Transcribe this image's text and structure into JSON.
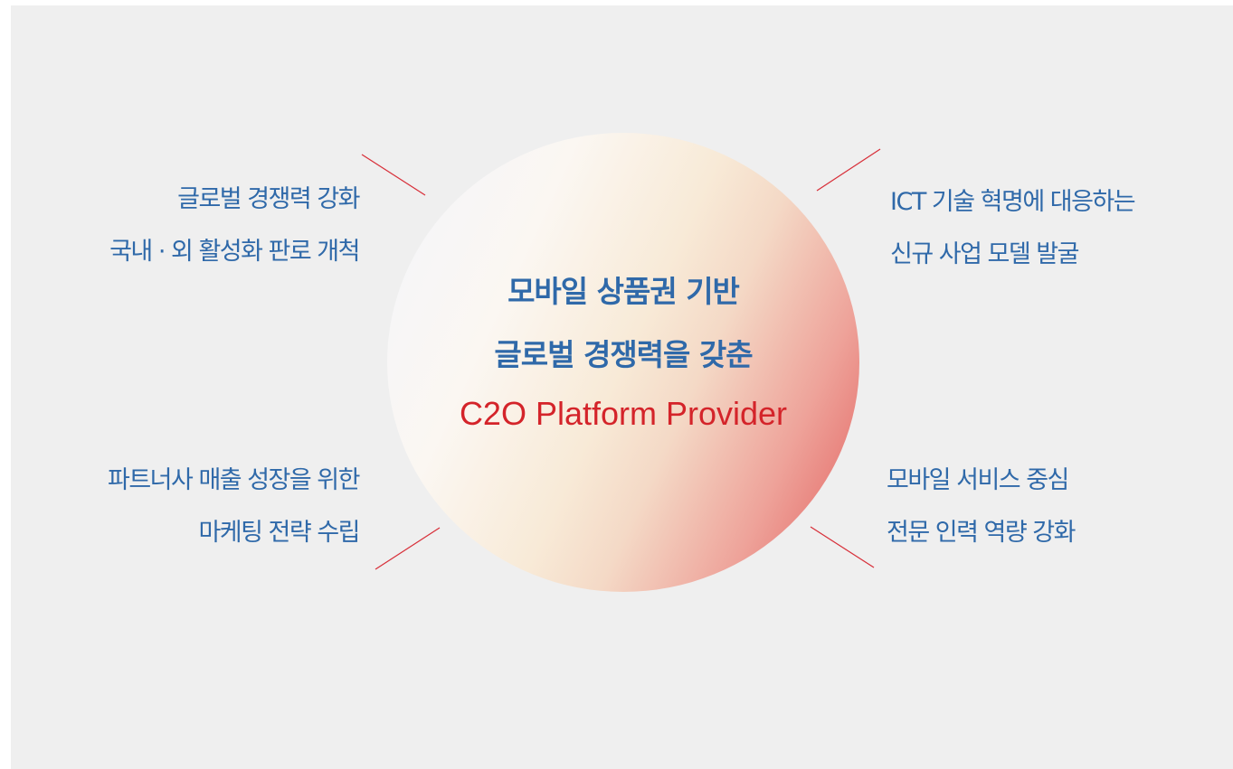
{
  "center": {
    "line1": "모바일 상품권 기반",
    "line2": "글로벌 경쟁력을 갖춘",
    "line3": "C2O Platform Provider"
  },
  "top_left": {
    "line1": "글로벌 경쟁력 강화",
    "line2": "국내 · 외 활성화 판로 개척"
  },
  "top_right": {
    "line1": "ICT 기술 혁명에 대응하는",
    "line2": "신규 사업 모델 발굴"
  },
  "bottom_left": {
    "line1": "파트너사 매출 성장을 위한",
    "line2": "마케팅 전략 수립"
  },
  "bottom_right": {
    "line1": "모바일 서비스 중심",
    "line2": "전문 인력 역량 강화"
  },
  "colors": {
    "text_blue": "#2f69a9",
    "accent_red": "#d4242a",
    "background": "#efefef"
  }
}
